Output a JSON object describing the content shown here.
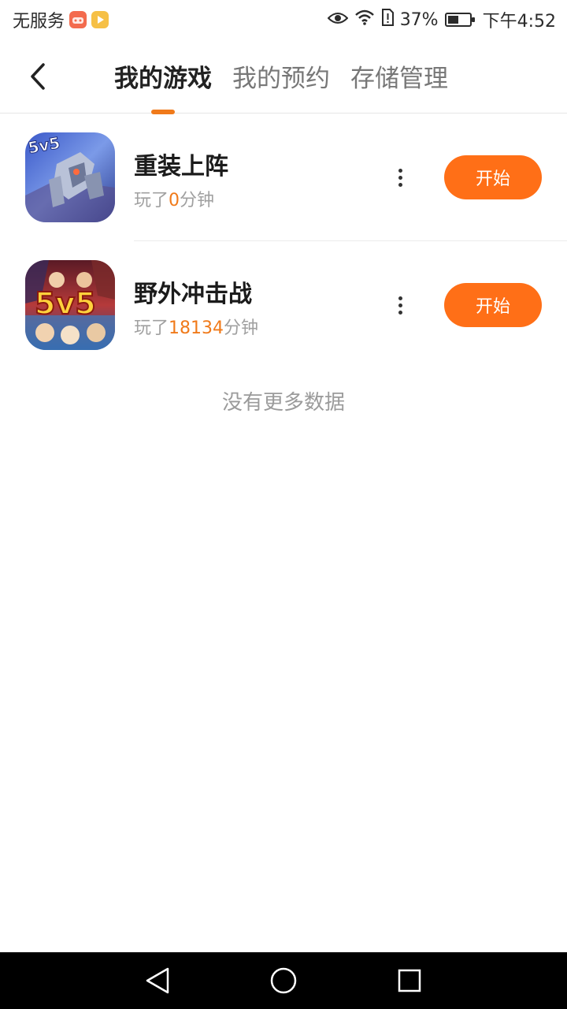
{
  "status": {
    "carrier": "无服务",
    "battery_percent": "37%",
    "time": "下午4:52"
  },
  "tabs": [
    {
      "label": "我的游戏",
      "active": true
    },
    {
      "label": "我的预约",
      "active": false
    },
    {
      "label": "存储管理",
      "active": false
    }
  ],
  "games": [
    {
      "name": "重装上阵",
      "played_prefix": "玩了",
      "minutes": "0",
      "played_suffix": "分钟",
      "button": "开始",
      "icon": "mech-robot-5v5-icon"
    },
    {
      "name": "野外冲击战",
      "played_prefix": "玩了",
      "minutes": "18134",
      "played_suffix": "分钟",
      "button": "开始",
      "icon": "heroes-5v5-icon"
    }
  ],
  "footer_text": "没有更多数据",
  "colors": {
    "accent": "#ff6f17",
    "accent_text": "#f07a1a"
  }
}
